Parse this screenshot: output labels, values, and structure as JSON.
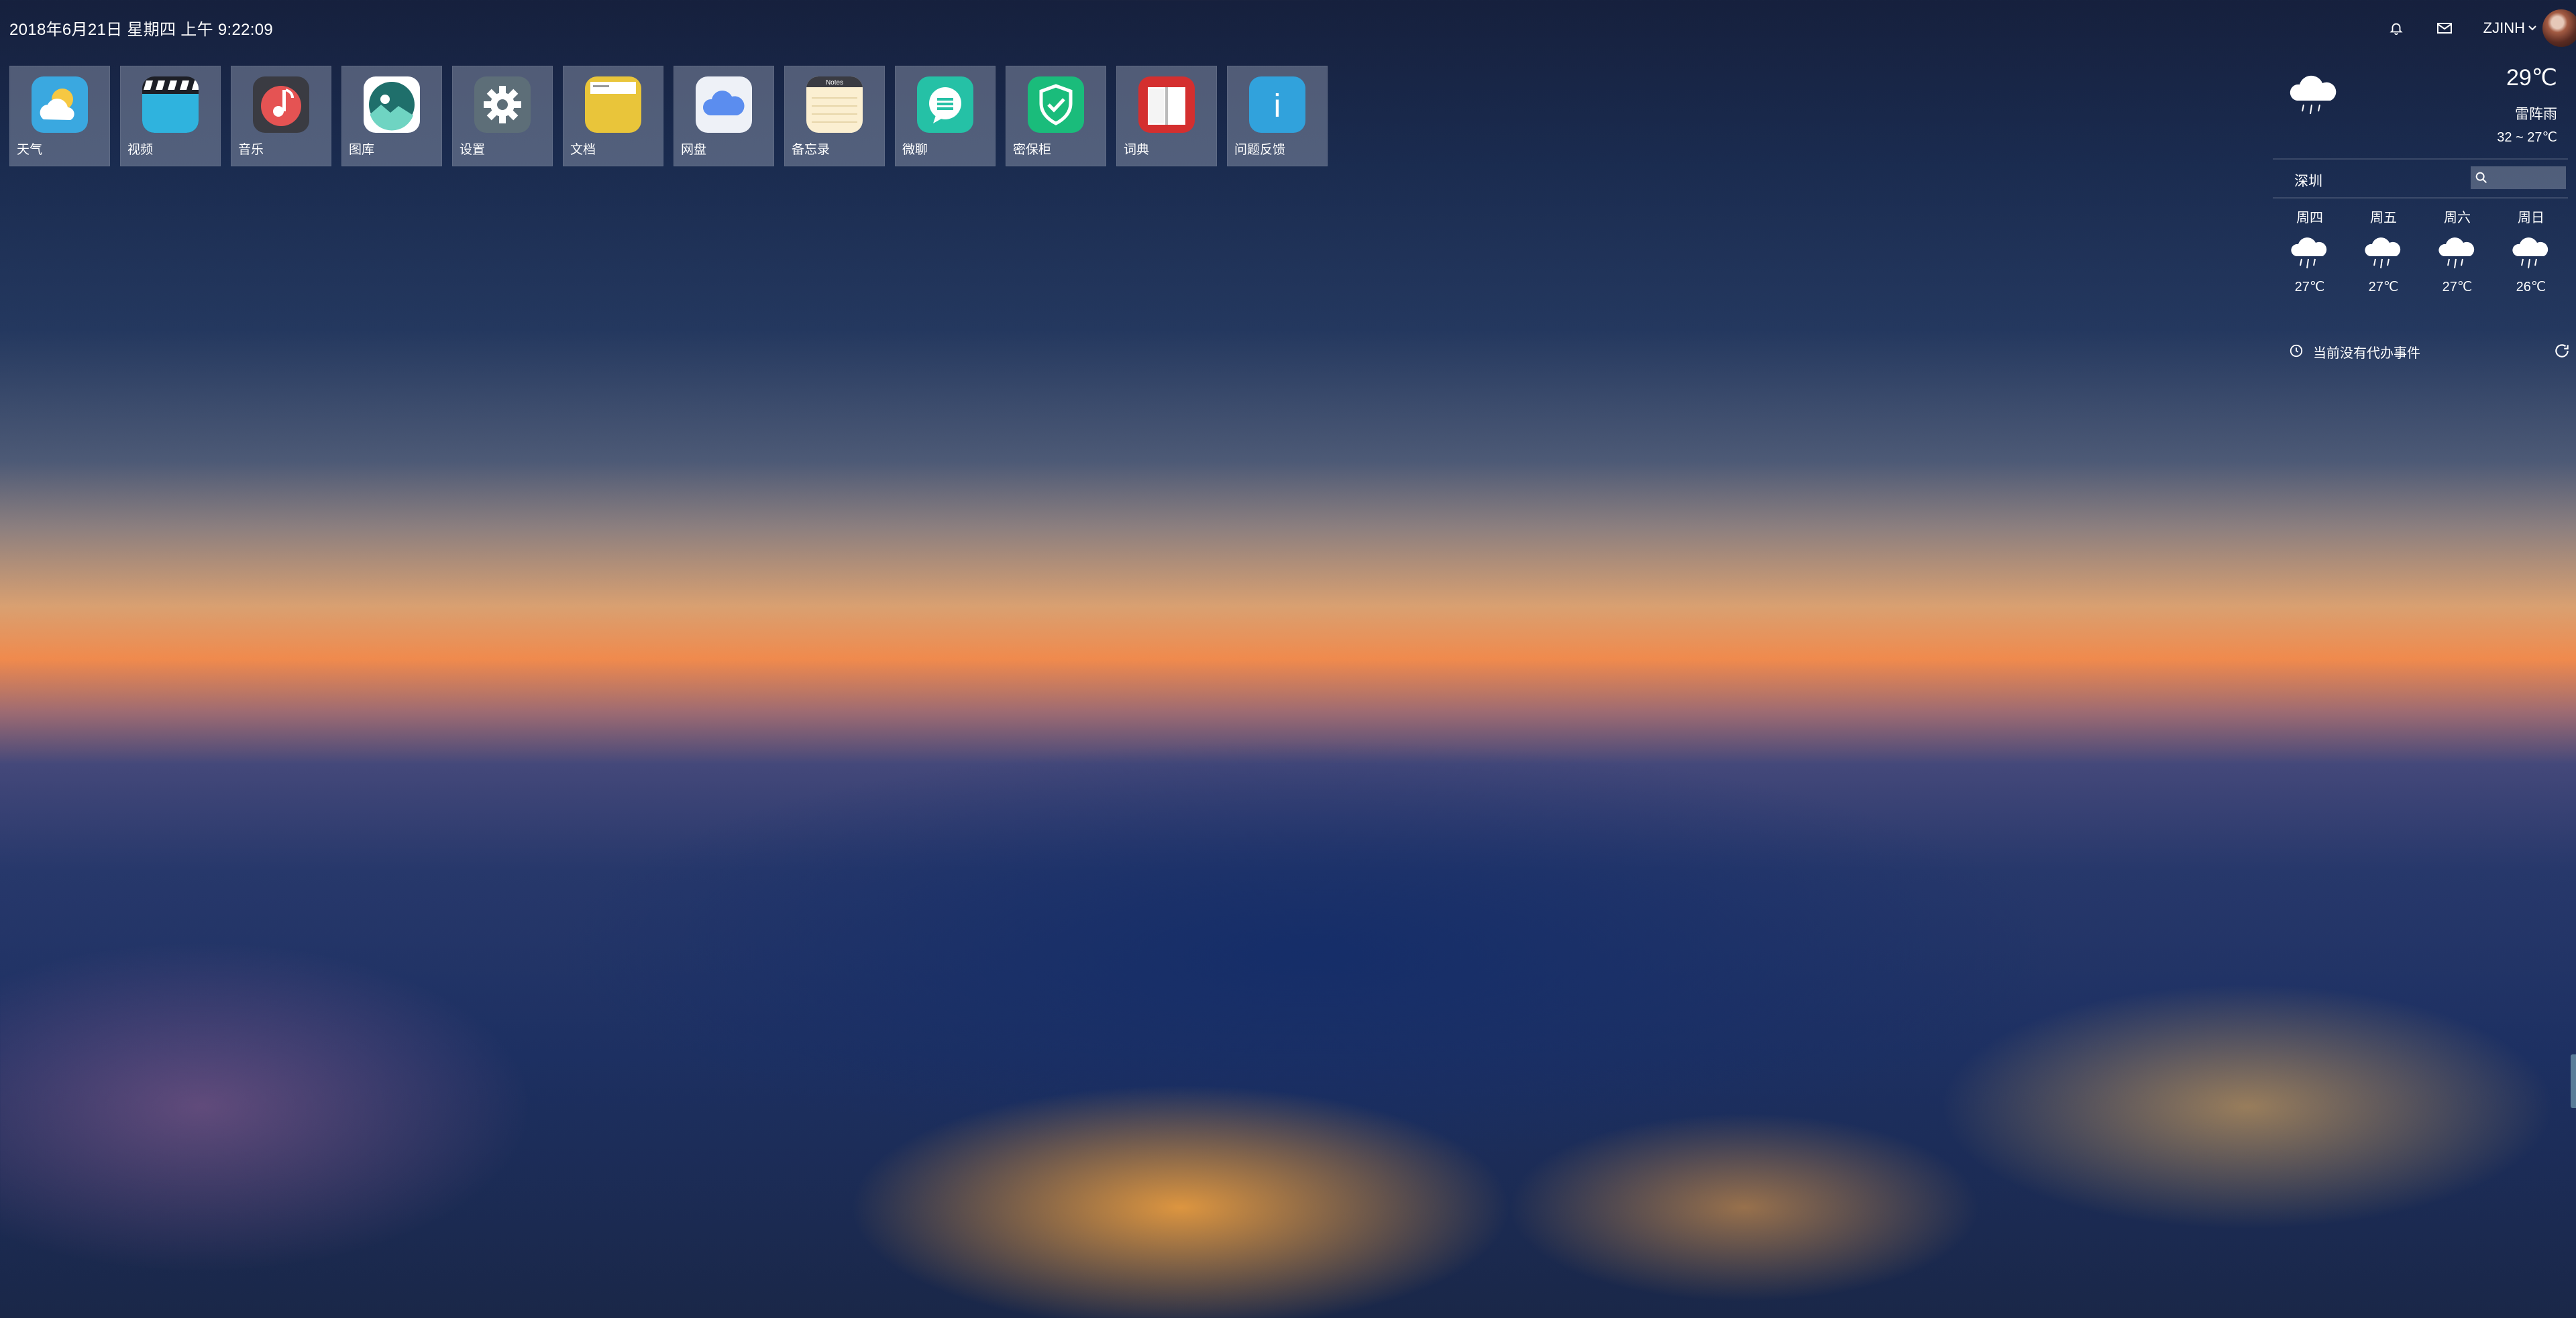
{
  "topbar": {
    "datetime": "2018年6月21日 星期四 上午 9:22:09",
    "user_name": "ZJINH",
    "icons": [
      "bell-icon",
      "mail-icon",
      "chevron-down-icon"
    ]
  },
  "apps": [
    {
      "label": "天气",
      "icon": "weather-app-icon",
      "color": "#3aa8e0"
    },
    {
      "label": "视频",
      "icon": "video-app-icon",
      "color": "#2fb3de"
    },
    {
      "label": "音乐",
      "icon": "music-app-icon",
      "color": "#e55353"
    },
    {
      "label": "图库",
      "icon": "gallery-app-icon",
      "color": "#2a9d8f"
    },
    {
      "label": "设置",
      "icon": "settings-app-icon",
      "color": "#5d6e78"
    },
    {
      "label": "文档",
      "icon": "docs-app-icon",
      "color": "#e9c53a"
    },
    {
      "label": "网盘",
      "icon": "cloud-drive-app-icon",
      "color": "#5b8def"
    },
    {
      "label": "备忘录",
      "icon": "notes-app-icon",
      "color": "#fbefd1",
      "icon_text": "Notes"
    },
    {
      "label": "微聊",
      "icon": "chat-app-icon",
      "color": "#25c1a6"
    },
    {
      "label": "密保柜",
      "icon": "vault-app-icon",
      "color": "#1abc7b"
    },
    {
      "label": "词典",
      "icon": "dictionary-app-icon",
      "color": "#d42f2f"
    },
    {
      "label": "问题反馈",
      "icon": "feedback-app-icon",
      "color": "#31a2dc",
      "icon_text": "i"
    }
  ],
  "weather": {
    "current_temp": "29℃",
    "current_desc": "雷阵雨",
    "current_range": "32 ~ 27℃",
    "city": "深圳",
    "search_placeholder": "",
    "forecast": [
      {
        "day": "周四",
        "temp": "27℃",
        "icon": "rain-cloud-icon"
      },
      {
        "day": "周五",
        "temp": "27℃",
        "icon": "rain-cloud-icon"
      },
      {
        "day": "周六",
        "temp": "27℃",
        "icon": "rain-cloud-icon"
      },
      {
        "day": "周日",
        "temp": "26℃",
        "icon": "rain-cloud-icon"
      }
    ],
    "todo_text": "当前没有代办事件"
  }
}
